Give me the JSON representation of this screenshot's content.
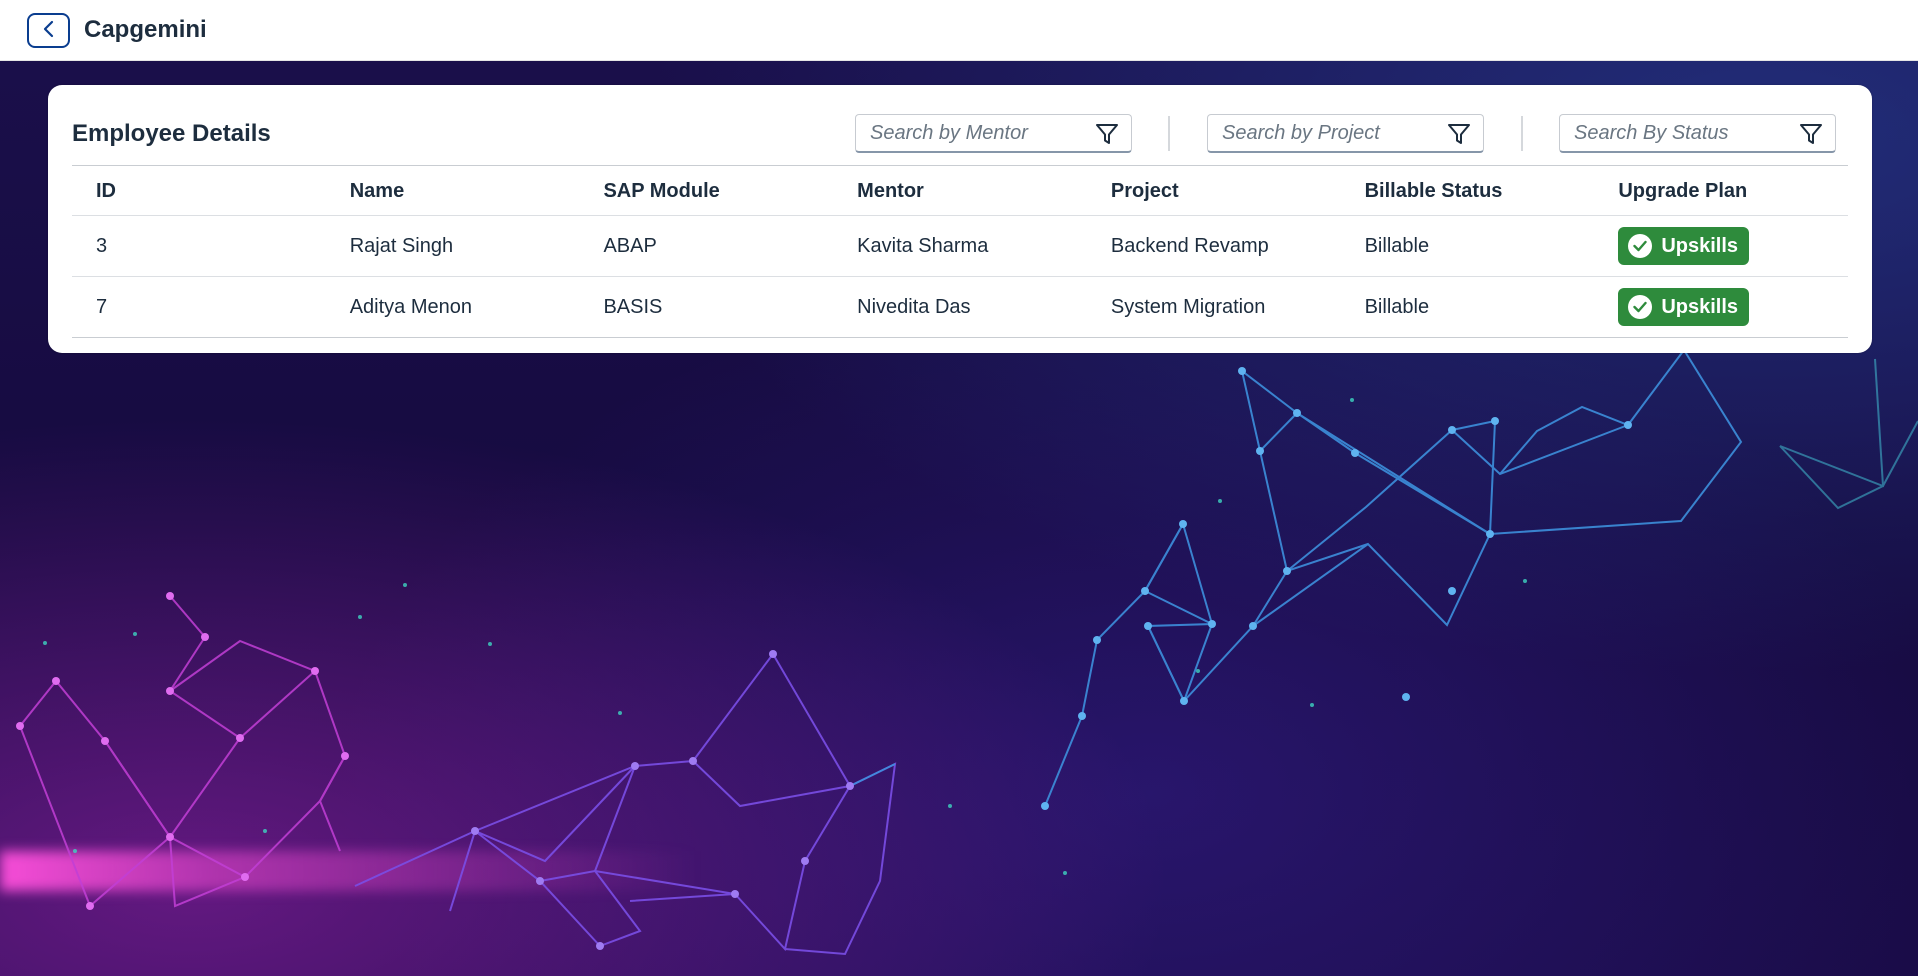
{
  "header": {
    "back_icon": "chevron-left-icon",
    "title": "Capgemini"
  },
  "card": {
    "title": "Employee Details",
    "filters": [
      {
        "placeholder": "Search by Mentor",
        "icon": "filter-icon"
      },
      {
        "placeholder": "Search by Project",
        "icon": "filter-icon"
      },
      {
        "placeholder": "Search By Status",
        "icon": "filter-icon"
      }
    ]
  },
  "table": {
    "columns": [
      "ID",
      "Name",
      "SAP Module",
      "Mentor",
      "Project",
      "Billable Status",
      "Upgrade Plan"
    ],
    "rows": [
      {
        "id": "3",
        "name": "Rajat Singh",
        "module": "ABAP",
        "mentor": "Kavita Sharma",
        "project": "Backend Revamp",
        "billable": "Billable",
        "plan": "Upskills"
      },
      {
        "id": "7",
        "name": "Aditya Menon",
        "module": "BASIS",
        "mentor": "Nivedita Das",
        "project": "System Migration",
        "billable": "Billable",
        "plan": "Upskills"
      }
    ],
    "badge_icon": "check-circle-icon",
    "badge_color": "#2e8b3c"
  },
  "colors": {
    "accent": "#0a3d8f",
    "background": "#120a35"
  }
}
